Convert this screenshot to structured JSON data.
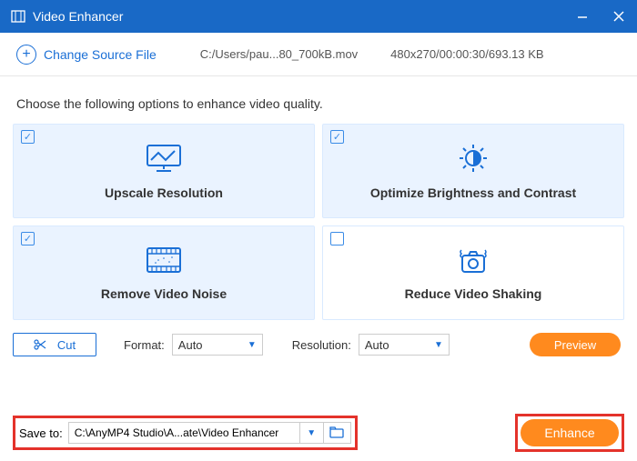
{
  "titlebar": {
    "title": "Video Enhancer"
  },
  "toolbar": {
    "change_source": "Change Source File",
    "file_path": "C:/Users/pau...80_700kB.mov",
    "file_info": "480x270/00:00:30/693.13 KB"
  },
  "instruction": "Choose the following options to enhance video quality.",
  "cards": [
    {
      "label": "Upscale Resolution",
      "checked": true
    },
    {
      "label": "Optimize Brightness and Contrast",
      "checked": true
    },
    {
      "label": "Remove Video Noise",
      "checked": true
    },
    {
      "label": "Reduce Video Shaking",
      "checked": false
    }
  ],
  "options": {
    "cut_label": "Cut",
    "format_label": "Format:",
    "format_value": "Auto",
    "resolution_label": "Resolution:",
    "resolution_value": "Auto",
    "preview_label": "Preview"
  },
  "save": {
    "label": "Save to:",
    "path": "C:\\AnyMP4 Studio\\A...ate\\Video Enhancer",
    "enhance_label": "Enhance"
  }
}
